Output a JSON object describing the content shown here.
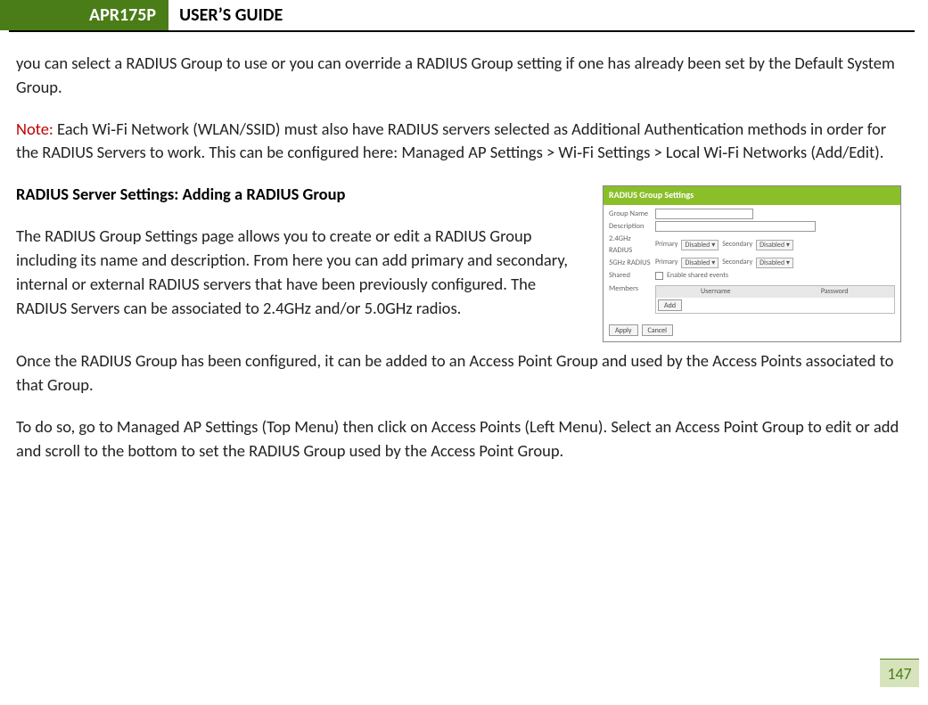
{
  "header": {
    "model": "APR175P",
    "title": "USER’S GUIDE"
  },
  "body": {
    "p1": "you can select a RADIUS Group to use or you can override a RADIUS Group setting if one has already been set by the Default System Group.",
    "note_label": "Note:",
    "note_text": " Each Wi‑Fi Network (WLAN/SSID) must also have RADIUS servers selected as Additional Authentication methods in order for the RADIUS Servers to work.  This can be configured here: Managed AP Settings > Wi‑Fi Settings > Local Wi‑Fi Networks (Add/Edit).",
    "heading": "RADIUS Server Settings: Adding a RADIUS Group",
    "p2": "The RADIUS Group Settings page allows you to create or edit a RADIUS Group including its name and description. From here you can add primary and secondary, internal or external RADIUS servers that have been previously configured. The RADIUS Servers can be associated to 2.4GHz and/or 5.0GHz radios.",
    "p3": "Once the RADIUS Group has been configured, it can be added to an Access Point Group and used by the Access Points associated to that Group.",
    "p4": "To do so, go to Managed AP Settings (Top Menu) then click on Access Points (Left Menu).  Select an Access Point Group to edit or add and scroll to the bottom to set the RADIUS Group used by the Access Point Group."
  },
  "figure": {
    "title": "RADIUS Group Settings",
    "labels": {
      "group_name": "Group Name",
      "description": "Description",
      "radius_24": "2.4GHz RADIUS",
      "radius_50": "5GHz RADIUS",
      "shared": "Shared",
      "members": "Members"
    },
    "sub": {
      "primary": "Primary",
      "secondary": "Secondary"
    },
    "select_value": "Disabled ▾",
    "checkbox_label": "Enable shared events",
    "table_headers": [
      "Username",
      "Password"
    ],
    "buttons": {
      "add": "Add",
      "apply": "Apply",
      "cancel": "Cancel"
    }
  },
  "page_number": "147"
}
